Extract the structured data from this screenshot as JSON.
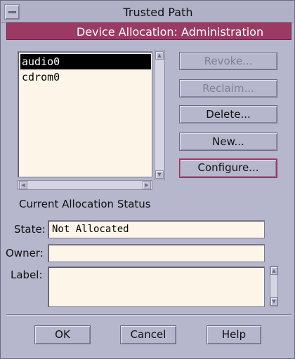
{
  "window": {
    "title": "Trusted Path"
  },
  "dialog": {
    "title": "Device Allocation: Administration"
  },
  "devices": {
    "items": [
      "audio0",
      "cdrom0"
    ],
    "selected": "audio0"
  },
  "actions": {
    "revoke": "Revoke...",
    "reclaim": "Reclaim...",
    "delete": "Delete...",
    "new": "New...",
    "configure": "Configure..."
  },
  "status": {
    "heading": "Current Allocation Status",
    "state_label": "State:",
    "state_value": "Not Allocated",
    "owner_label": "Owner:",
    "owner_value": "",
    "label_label": "Label:",
    "label_value": ""
  },
  "footer": {
    "ok": "OK",
    "cancel": "Cancel",
    "help": "Help"
  },
  "colors": {
    "title_bar": "#9b3a63",
    "background": "#b6b6cc",
    "field": "#fdf6e8"
  }
}
